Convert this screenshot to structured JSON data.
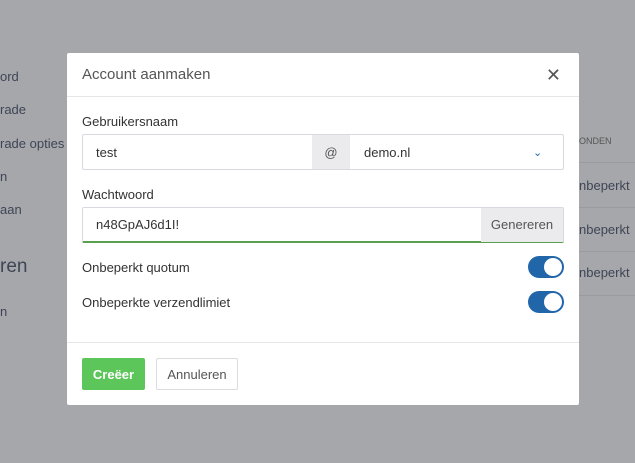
{
  "background": {
    "sidebar": [
      "ord",
      "rade",
      "rade opties",
      "n",
      "aan",
      "ren",
      "n"
    ],
    "table_header": "ONDEN",
    "table_cells": [
      "nbeperkt",
      "nbeperkt",
      "nbeperkt"
    ]
  },
  "modal": {
    "title": "Account aanmaken",
    "close_icon": "close-icon",
    "username_label": "Gebruikersnaam",
    "username_value": "test",
    "at": "@",
    "domain_value": "demo.nl",
    "password_label": "Wachtwoord",
    "password_value": "n48GpAJ6d1I!",
    "generate_label": "Genereren",
    "toggles": [
      {
        "label": "Onbeperkt quotum",
        "on": true
      },
      {
        "label": "Onbeperkte verzendlimiet",
        "on": true
      }
    ],
    "create_label": "Creëer",
    "cancel_label": "Annuleren",
    "accent": "#2266aa",
    "success": "#5cc65a"
  }
}
